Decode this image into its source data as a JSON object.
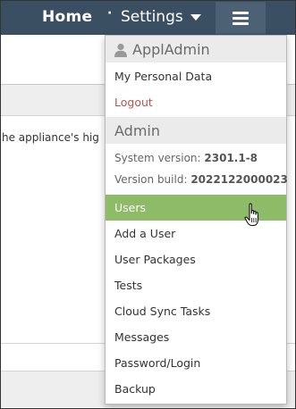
{
  "navbar": {
    "home_label": "Home",
    "separator": "·",
    "settings_label": "Settings",
    "menu_icon": "hamburger-icon"
  },
  "background": {
    "partial_text": "he appliance's hig"
  },
  "dropdown": {
    "appladmin_header": "ApplAdmin",
    "appladmin_icon": "user-icon",
    "my_personal_data": "My Personal Data",
    "logout": "Logout",
    "admin_header": "Admin",
    "system_version_label": "System version:",
    "system_version_value": "2301.1-8",
    "version_build_label": "Version build:",
    "version_build_value": "2022122000023",
    "items": [
      {
        "label": "Users",
        "active": true
      },
      {
        "label": "Add a User"
      },
      {
        "label": "User Packages"
      },
      {
        "label": "Tests"
      },
      {
        "label": "Cloud Sync Tasks"
      },
      {
        "label": "Messages"
      },
      {
        "label": "Password/Login"
      },
      {
        "label": "Backup"
      }
    ]
  },
  "colors": {
    "navbar": "#3b4f63",
    "active_item": "#8ebb67",
    "logout_text": "#b85450"
  }
}
